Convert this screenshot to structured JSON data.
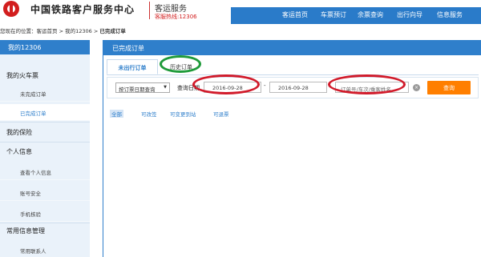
{
  "header": {
    "site_name": "中国铁路客户服务中心",
    "sub_name": "客运服务",
    "hotline": "客服热线:12306",
    "nav": [
      "客运首页",
      "车票预订",
      "余票查询",
      "出行向导",
      "信息服务"
    ]
  },
  "breadcrumb": {
    "prefix": "您现在的位置：客运首页 > 我的12306 >",
    "current": "已完成订单"
  },
  "sidebar": {
    "title": "我的12306",
    "sections": [
      {
        "label": "我的火车票",
        "items": [
          "未完成订单",
          "已完成订单"
        ]
      },
      {
        "label": "我的保险",
        "items": []
      },
      {
        "label": "个人信息",
        "items": [
          "查看个人信息",
          "账号安全",
          "手机核验"
        ]
      },
      {
        "label": "常用信息管理",
        "items": [
          "常用联系人"
        ]
      }
    ]
  },
  "content": {
    "title": "已完成订单",
    "tabs": [
      "未出行订单",
      "历史订单"
    ],
    "query": {
      "select_value": "按订票日期查询",
      "date_label": "查询日期",
      "start_date": "2016-09-28",
      "date_separator": "-",
      "end_date": "2016-09-28",
      "keyword_placeholder": "订单号/车次/乘客姓名",
      "clear_icon": "×",
      "button": "查询"
    },
    "filters": [
      "全部",
      "可改签",
      "可变更到站",
      "可退票"
    ]
  },
  "colors": {
    "brand_blue": "#2f7fcb",
    "nav_blue": "#2a7bc9",
    "accent_orange": "#ff7f00",
    "logo_red": "#d21e1e",
    "annotation_red": "#d11a2a",
    "annotation_green": "#1f9a3a"
  }
}
